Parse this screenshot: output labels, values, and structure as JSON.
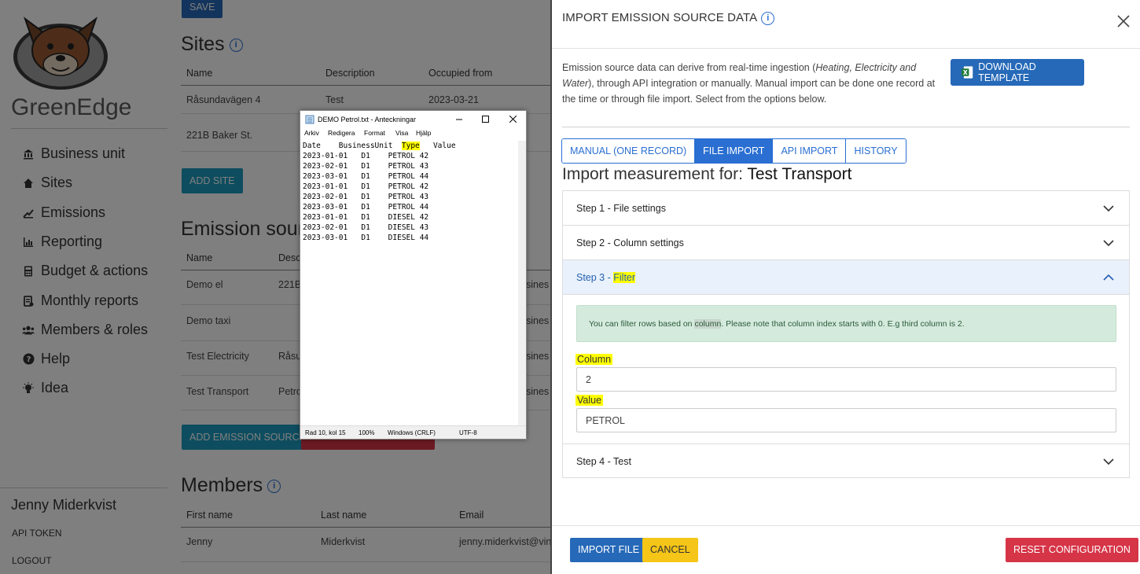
{
  "sidebar": {
    "brand": "GreenEdge",
    "nav": [
      {
        "icon": "bank-icon",
        "label": "Business unit"
      },
      {
        "icon": "home-icon",
        "label": "Sites"
      },
      {
        "icon": "emissions-icon",
        "label": "Emissions"
      },
      {
        "icon": "chart-icon",
        "label": "Reporting"
      },
      {
        "icon": "calculator-icon",
        "label": "Budget & actions"
      },
      {
        "icon": "report-icon",
        "label": "Monthly reports"
      },
      {
        "icon": "users-icon",
        "label": "Members & roles"
      },
      {
        "icon": "help-icon",
        "label": "Help"
      },
      {
        "icon": "lightbulb-icon",
        "label": "Idea"
      }
    ],
    "user": "Jenny Miderkvist",
    "api_token": "API TOKEN",
    "logout": "LOGOUT"
  },
  "main": {
    "save_button": "SAVE",
    "sites_heading": "Sites",
    "sites_headers": [
      "Name",
      "Description",
      "Occupied from"
    ],
    "sites_rows": [
      [
        "Råsundavägen 4",
        "Test",
        "2023-03-21"
      ],
      [
        "221B Baker St.",
        "",
        ""
      ]
    ],
    "add_site": "ADD SITE",
    "emission_heading": "Emission sourc",
    "emission_headers": [
      "Name",
      "Desc"
    ],
    "emission_rows": [
      [
        "Demo el",
        "221B",
        "sines"
      ],
      [
        "Demo taxi",
        "",
        "sines"
      ],
      [
        "Test Electricity",
        "Råsu",
        "sines"
      ],
      [
        "Test Transport",
        "Petro",
        "sines"
      ]
    ],
    "add_emission": "ADD EMISSION SOURCE",
    "members_heading": "Members",
    "members_headers": [
      "First name",
      "Last name",
      "Email"
    ],
    "members_rows": [
      [
        "Jenny",
        "Miderkvist",
        "jenny.miderkvist@vinci"
      ]
    ]
  },
  "notepad": {
    "title": "DEMO Petrol.txt - Anteckningar",
    "menu": [
      "Arkiv",
      "Redigera",
      "Format",
      "Visa",
      "Hjälp"
    ],
    "header": [
      "Date",
      "BusinessUnit",
      "Type",
      "Value"
    ],
    "rows": [
      [
        "2023-01-01",
        "D1",
        "PETROL",
        "42"
      ],
      [
        "2023-02-01",
        "D1",
        "PETROL",
        "43"
      ],
      [
        "2023-03-01",
        "D1",
        "PETROL",
        "44"
      ],
      [
        "2023-01-01",
        "D1",
        "PETROL",
        "42"
      ],
      [
        "2023-02-01",
        "D1",
        "PETROL",
        "43"
      ],
      [
        "2023-03-01",
        "D1",
        "PETROL",
        "44"
      ],
      [
        "2023-01-01",
        "D1",
        "DIESEL",
        "42"
      ],
      [
        "2023-02-01",
        "D1",
        "DIESEL",
        "43"
      ],
      [
        "2023-03-01",
        "D1",
        "DIESEL",
        "44"
      ]
    ],
    "status": {
      "pos": "Rad 10, kol 15",
      "zoom": "100%",
      "eol": "Windows (CRLF)",
      "enc": "UTF-8"
    }
  },
  "modal": {
    "title": "IMPORT EMISSION SOURCE DATA",
    "intro_parts": [
      "Emission source data can derive from real-time ingestion (",
      "Heating, Electricity and Water",
      "), through API integration or manually. Manual import can be done one record at the time or through file import. Select from the options below."
    ],
    "download_template": "DOWNLOAD TEMPLATE",
    "tabs": [
      "MANUAL (ONE RECORD)",
      "FILE IMPORT",
      "API IMPORT",
      "HISTORY"
    ],
    "active_tab": "FILE IMPORT",
    "import_for_label": "Import measurement for: ",
    "import_for_name": "Test Transport",
    "steps": [
      "Step 1 - File settings",
      "Step 2 - Column settings",
      "Step 3 - ",
      "Step 4 - Test"
    ],
    "step3_highlight": "Filter",
    "filter_help_parts": [
      "You can filter rows based on ",
      "column",
      ". Please note that column index starts with 0. E.g third column is 2."
    ],
    "column_label": "Column",
    "column_value": "2",
    "value_label": "Value",
    "value_value": "PETROL",
    "import_file": "IMPORT FILE",
    "cancel": "CANCEL",
    "reset": "RESET CONFIGURATION",
    "colors": {
      "primary": "#2a6fd1",
      "warning": "#f5c518",
      "danger": "#d63447",
      "highlight": "#ffff00"
    }
  }
}
